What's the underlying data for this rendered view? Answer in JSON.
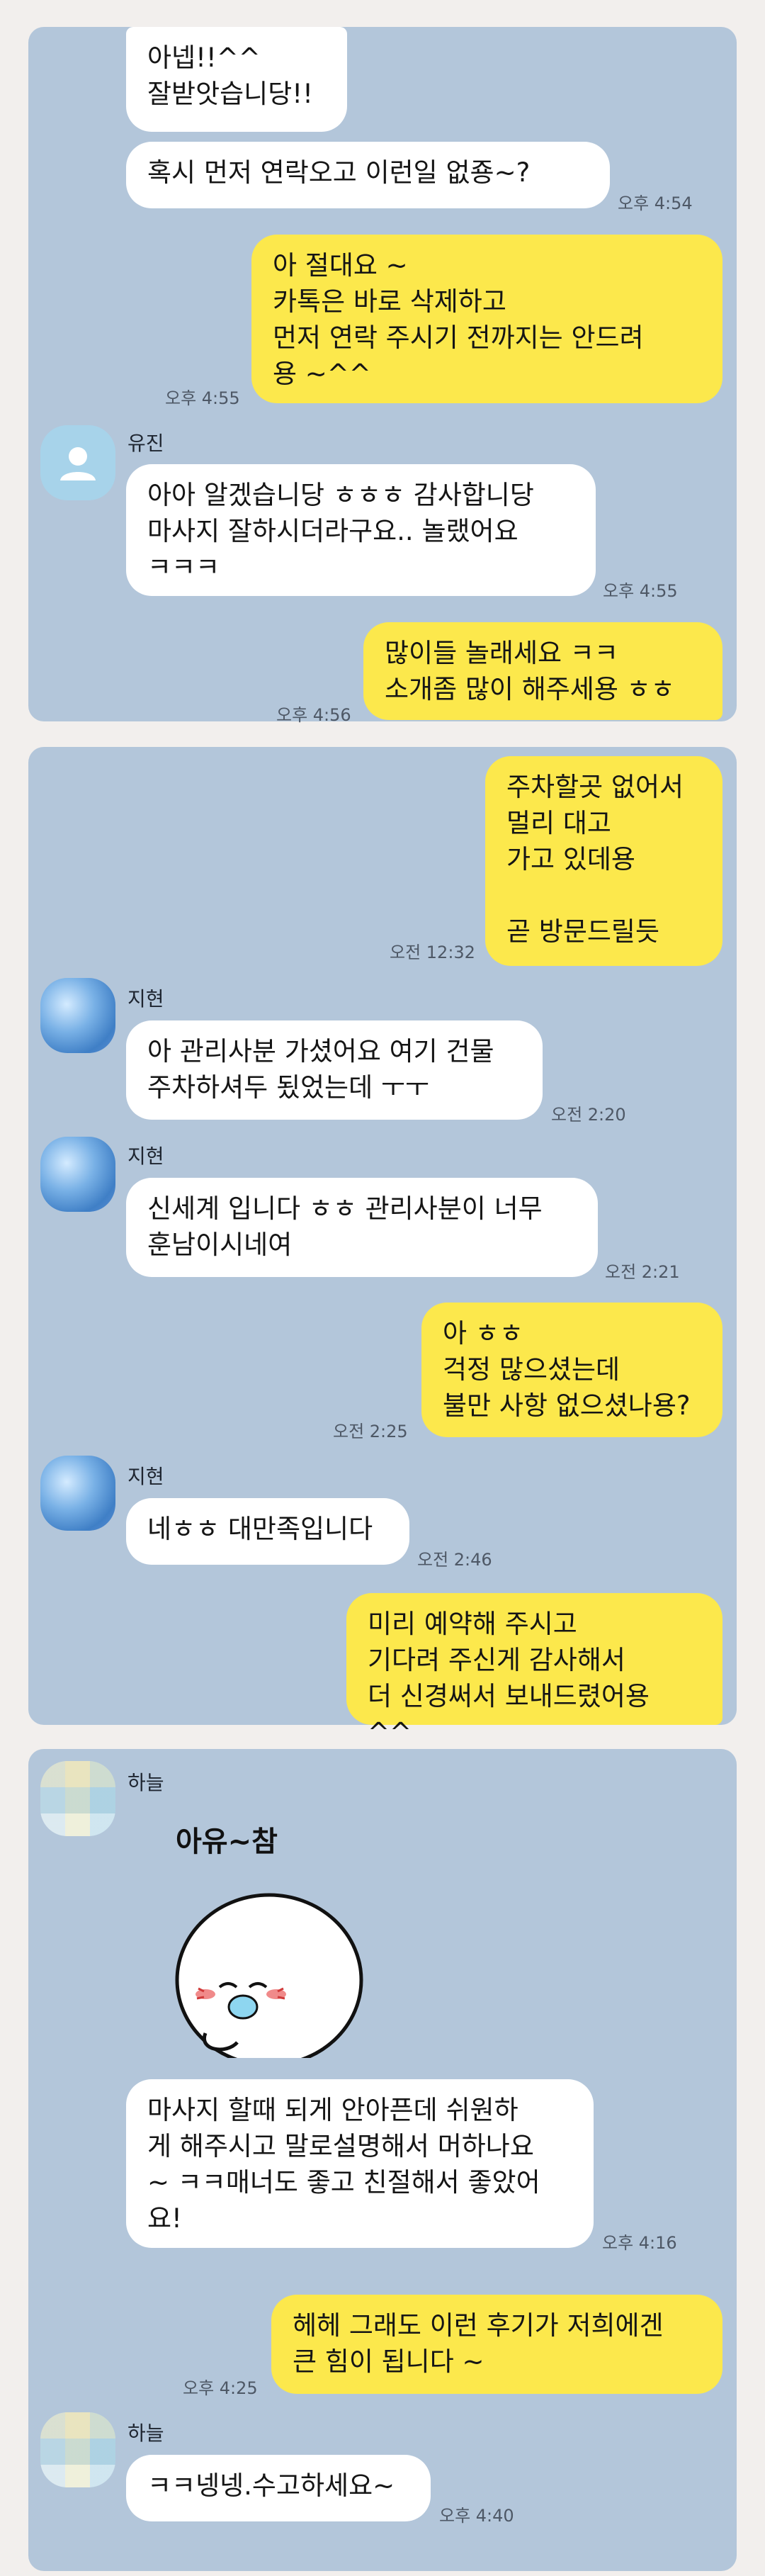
{
  "panels": [
    {
      "messages": [
        {
          "dir": "in",
          "text": "아넵!!^^\n잘받앗습니당!!"
        },
        {
          "dir": "in",
          "text": "혹시 먼저 연락오고 이런일 없죵~?",
          "time": "오후 4:54"
        },
        {
          "dir": "out",
          "text": "아 절대요 ~\n카톡은 바로 삭제하고\n먼저 연락 주시기 전까지는 안드려\n용 ~^^",
          "time": "오후 4:55"
        },
        {
          "dir": "in",
          "sender": "유진",
          "text": "아아 알겠습니당 ㅎㅎㅎ 감사합니당\n마사지 잘하시더라구요.. 놀랬어요\nㅋㅋㅋ",
          "time": "오후 4:55"
        },
        {
          "dir": "out",
          "text": "많이들 놀래세요 ㅋㅋ\n소개좀 많이 해주세용 ㅎㅎ",
          "time": "오후 4:56"
        }
      ]
    },
    {
      "messages": [
        {
          "dir": "out",
          "text": "주차할곳 없어서\n멀리 대고\n가고 있데용\n\n곧 방문드릴듯",
          "time": "오전 12:32"
        },
        {
          "dir": "in",
          "sender": "지현",
          "text": "아 관리사분 가셨어요 여기 건물\n주차하셔두 됬었는데 ㅜㅜ",
          "time": "오전 2:20"
        },
        {
          "dir": "in",
          "sender": "지현",
          "text": "신세계 입니다 ㅎㅎ 관리사분이 너무\n훈남이시네여",
          "time": "오전 2:21"
        },
        {
          "dir": "out",
          "text": "아 ㅎㅎ\n걱정 많으셨는데\n불만 사항 없으셨나용?",
          "time": "오전 2:25"
        },
        {
          "dir": "in",
          "sender": "지현",
          "text": "네ㅎㅎ 대만족입니다",
          "time": "오전 2:46"
        },
        {
          "dir": "out",
          "text": "미리 예약해 주시고\n기다려 주신게 감사해서\n더 신경써서 보내드렸어용 ^^"
        }
      ]
    },
    {
      "messages": [
        {
          "dir": "in",
          "sender": "하늘",
          "sticker_text": "아유~참"
        },
        {
          "dir": "in",
          "text": "마사지 할때 되게 안아픈데 쉬원하\n게 해주시고 말로설명해서 머하나요\n~ ㅋㅋ매너도 좋고 친절해서 좋았어\n요!",
          "time": "오후 4:16"
        },
        {
          "dir": "out",
          "text": "헤헤 그래도 이런 후기가 저희에겐\n큰 힘이 됩니다 ~",
          "time": "오후 4:25"
        },
        {
          "dir": "in",
          "sender": "하늘",
          "text": "ㅋㅋ넹넹.수고하세요~",
          "time": "오후 4:40"
        }
      ]
    }
  ],
  "theme": {
    "page_bg": "#f2efed",
    "chat_bg": "#b3c6da",
    "incoming_bubble": "#ffffff",
    "outgoing_bubble": "#fce84c"
  },
  "icons": {
    "default_avatar": "person-icon",
    "sticker": "blushing-face-sticker"
  }
}
